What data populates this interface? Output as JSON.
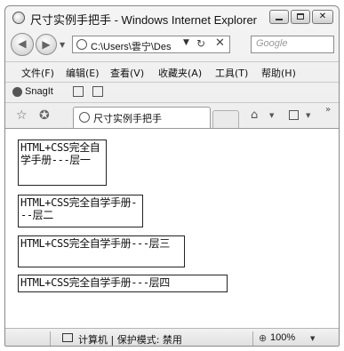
{
  "window": {
    "title": "尺寸实例手把手 - Windows Internet Explorer"
  },
  "caption_buttons": {
    "close": "✕"
  },
  "address_bar": {
    "url": "C:\\Users\\雲宁\\Des",
    "search_placeholder": "Google"
  },
  "menu": [
    {
      "label": "文件(F)"
    },
    {
      "label": "编辑(E)"
    },
    {
      "label": "查看(V)"
    },
    {
      "label": "收藏夹(A)"
    },
    {
      "label": "工具(T)"
    },
    {
      "label": "帮助(H)"
    }
  ],
  "snagit": {
    "label": "SnagIt"
  },
  "tab": {
    "label": "尺寸实例手把手"
  },
  "content": {
    "layers": [
      {
        "text": "HTML+CSS完全自学手册---层一"
      },
      {
        "text": "HTML+CSS完全自学手册---层二"
      },
      {
        "text": "HTML+CSS完全自学手册---层三"
      },
      {
        "text": "HTML+CSS完全自学手册---层四"
      }
    ]
  },
  "status": {
    "zone_text": "计算机 | 保护模式: 禁用",
    "zoom": "100%"
  },
  "icons": {
    "back": "arrow-left-icon",
    "forward": "arrow-right-icon",
    "refresh": "refresh-icon",
    "stop": "stop-icon",
    "favorites": "star-icon",
    "home": "home-icon",
    "feeds": "feed-icon"
  }
}
